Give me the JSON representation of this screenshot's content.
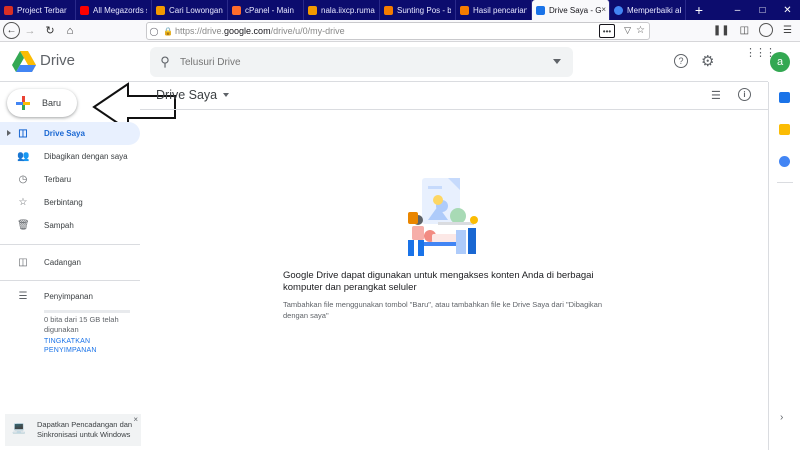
{
  "browser": {
    "tabs": [
      {
        "title": "Project Terbar",
        "color": "#d93025"
      },
      {
        "title": "All Megazords s",
        "color": "#ff0000"
      },
      {
        "title": "Cari Lowongan K",
        "color": "#f29900"
      },
      {
        "title": "cPanel - Main",
        "color": "#ff6c2c"
      },
      {
        "title": "nala.iixcp.rumah",
        "color": "#f29900"
      },
      {
        "title": "Sunting Pos - bu",
        "color": "#f57c00"
      },
      {
        "title": "Hasil pencarian",
        "color": "#f57c00"
      },
      {
        "title": "Drive Saya - G",
        "color": "#1a73e8",
        "active": true
      },
      {
        "title": "Memperbaiki ak",
        "color": "#4285f4"
      }
    ],
    "new_tab": "+",
    "url_host": "https://drive.",
    "url_domain": "google.com",
    "url_path": "/drive/u/0/my-drive",
    "more": "•••"
  },
  "drive": {
    "logo_text": "Drive",
    "search_placeholder": "Telusuri Drive",
    "avatar_letter": "a",
    "new_button": "Baru",
    "title": "Drive Saya",
    "nav": [
      {
        "label": "Drive Saya",
        "icon": "my-drive-icon",
        "active": true
      },
      {
        "label": "Dibagikan dengan saya",
        "icon": "shared-icon"
      },
      {
        "label": "Terbaru",
        "icon": "clock-icon"
      },
      {
        "label": "Berbintang",
        "icon": "star-icon"
      },
      {
        "label": "Sampah",
        "icon": "trash-icon"
      }
    ],
    "backups_label": "Cadangan",
    "storage_label": "Penyimpanan",
    "storage_text": "0 bita dari 15 GB telah digunakan",
    "storage_fraction": 0.0,
    "upgrade": "TINGKATKAN PENYIMPANAN",
    "empty_title": "Google Drive dapat digunakan untuk mengakses konten Anda di berbagai komputer dan perangkat seluler",
    "empty_sub": "Tambahkan file menggunakan tombol \"Baru\", atau tambahkan file ke Drive Saya dari \"Dibagikan dengan saya\"",
    "backup_banner": "Dapatkan Pencadangan dan Sinkronisasi untuk Windows",
    "close": "×"
  },
  "colors": {
    "accent": "#1a73e8",
    "active_bg": "#e8f0fe",
    "tabbar": "#0c0c6e"
  }
}
